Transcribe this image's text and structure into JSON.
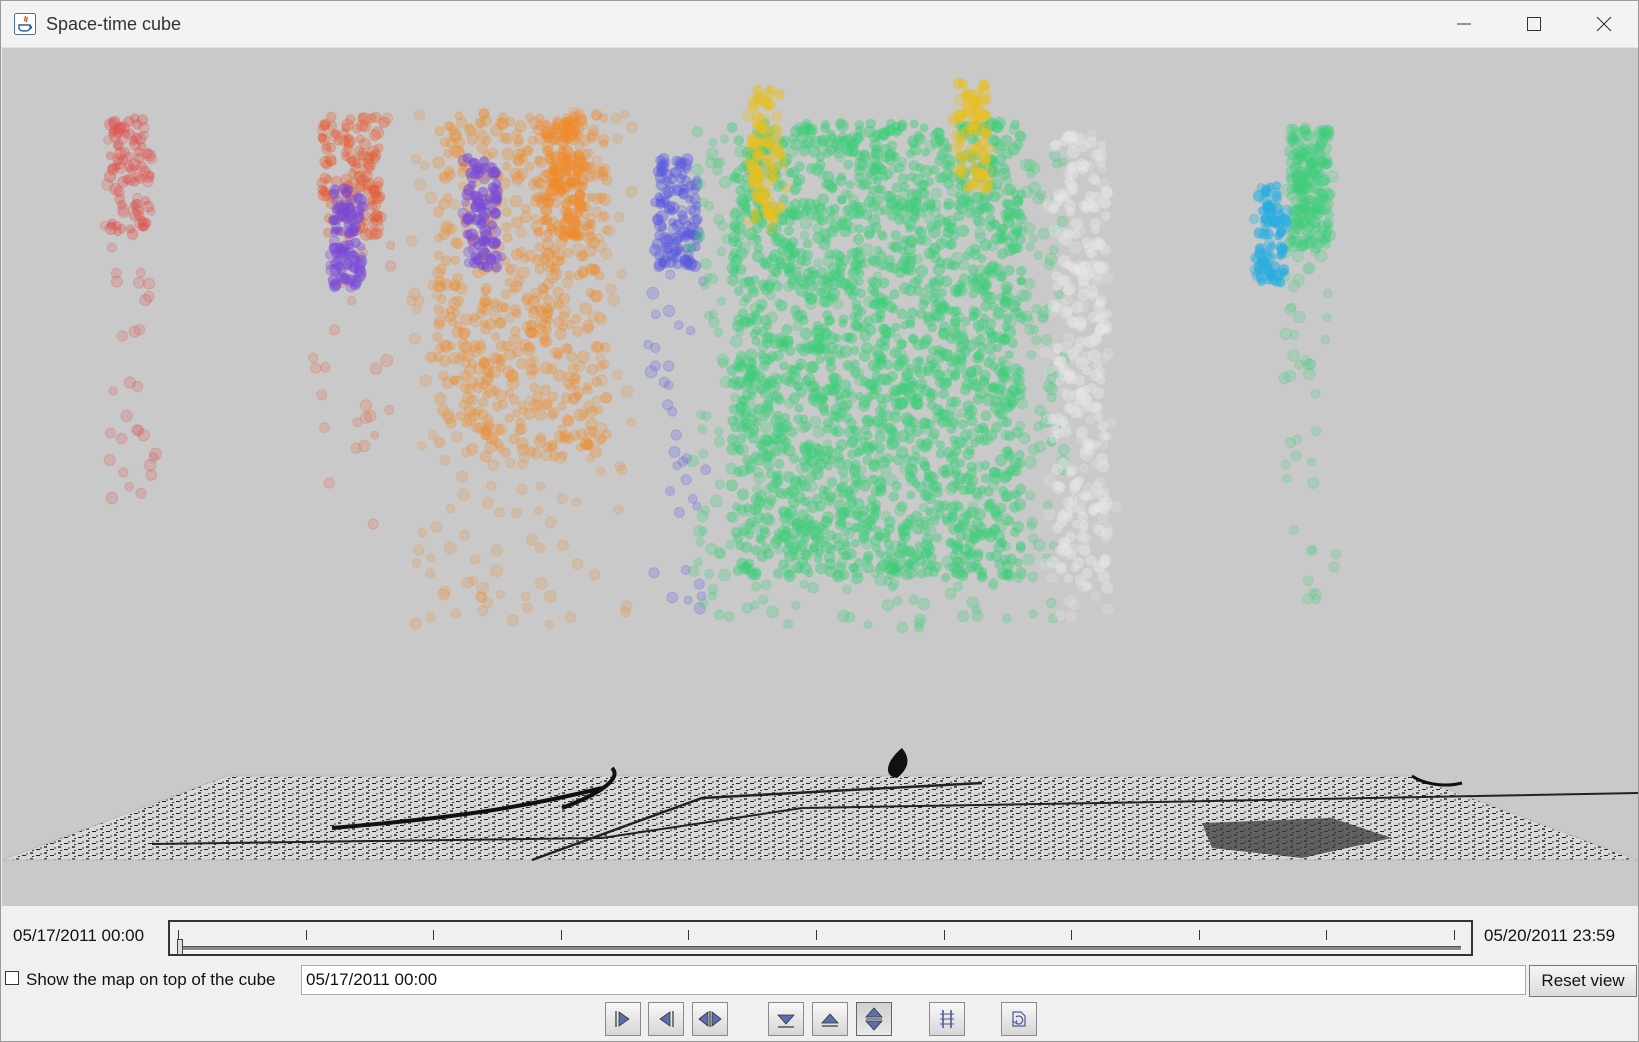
{
  "window": {
    "title": "Space-time cube"
  },
  "timeline": {
    "start_label": "05/17/2011 00:00",
    "end_label": "05/20/2011 23:59"
  },
  "options": {
    "show_map_label": "Show the map on top of the cube",
    "show_map_checked": false,
    "current_time_value": "05/17/2011 00:00",
    "reset_label": "Reset view"
  },
  "toolbar": {
    "buttons": [
      {
        "name": "play-forward-icon"
      },
      {
        "name": "play-backward-icon"
      },
      {
        "name": "play-both-directions-icon"
      },
      {
        "name": "move-down-icon"
      },
      {
        "name": "move-up-icon"
      },
      {
        "name": "move-up-down-icon"
      },
      {
        "name": "ladder-icon"
      },
      {
        "name": "rotate-cube-icon"
      }
    ]
  },
  "colors": {
    "scene_background": "#c9c9c9",
    "cluster_red": "#e0504a",
    "cluster_orange_red": "#e8562a",
    "cluster_purple": "#7a4ad6",
    "cluster_orange": "#f08a2a",
    "cluster_blue": "#5a5ae0",
    "cluster_green": "#3ecf7a",
    "cluster_yellow": "#e8c020",
    "cluster_gray": "#e6e6e6",
    "cluster_cyan": "#2aaee0"
  }
}
